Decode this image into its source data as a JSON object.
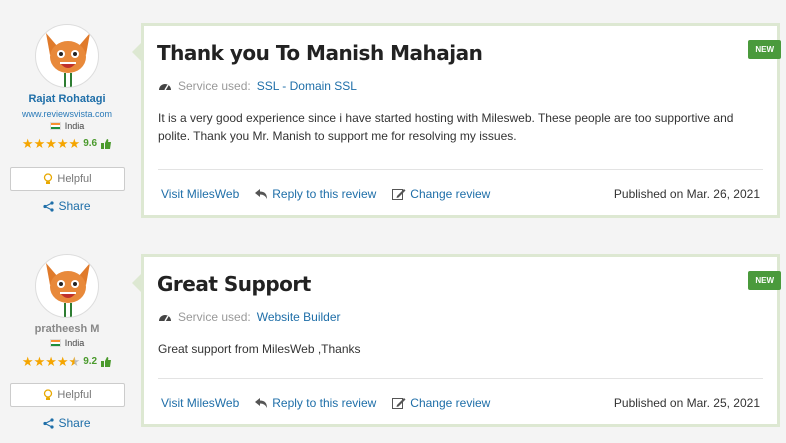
{
  "reviews": [
    {
      "author": {
        "name": "Rajat Rohatagi",
        "site": "www.reviewsvista.com",
        "country": "India",
        "rating": "9.6",
        "stars": 5
      },
      "helpful_label": "Helpful",
      "share_label": "Share",
      "badge": "NEW",
      "title": "Thank you To Manish Mahajan",
      "service_label": "Service used:",
      "service_value": "SSL - Domain SSL",
      "body": "It is a very good experience since i have started hosting with Milesweb. These people are too supportive and polite. Thank you Mr. Manish to support me for resolving my issues.",
      "visit_label": "Visit MilesWeb",
      "reply_label": "Reply to this review",
      "change_label": "Change review",
      "published": "Published on Mar. 26, 2021"
    },
    {
      "author": {
        "name": "pratheesh M",
        "site": "",
        "country": "India",
        "rating": "9.2",
        "stars": 4.5
      },
      "helpful_label": "Helpful",
      "share_label": "Share",
      "badge": "NEW",
      "title": "Great Support",
      "service_label": "Service used:",
      "service_value": "Website Builder",
      "body": "Great support from MilesWeb ,Thanks",
      "visit_label": "Visit MilesWeb",
      "reply_label": "Reply to this review",
      "change_label": "Change review",
      "published": "Published on Mar. 25, 2021"
    }
  ],
  "colors": {
    "accent": "#1e6ea8",
    "badge": "#4a9a3c",
    "star": "#f5a500",
    "card_border": "#dde8d2"
  }
}
